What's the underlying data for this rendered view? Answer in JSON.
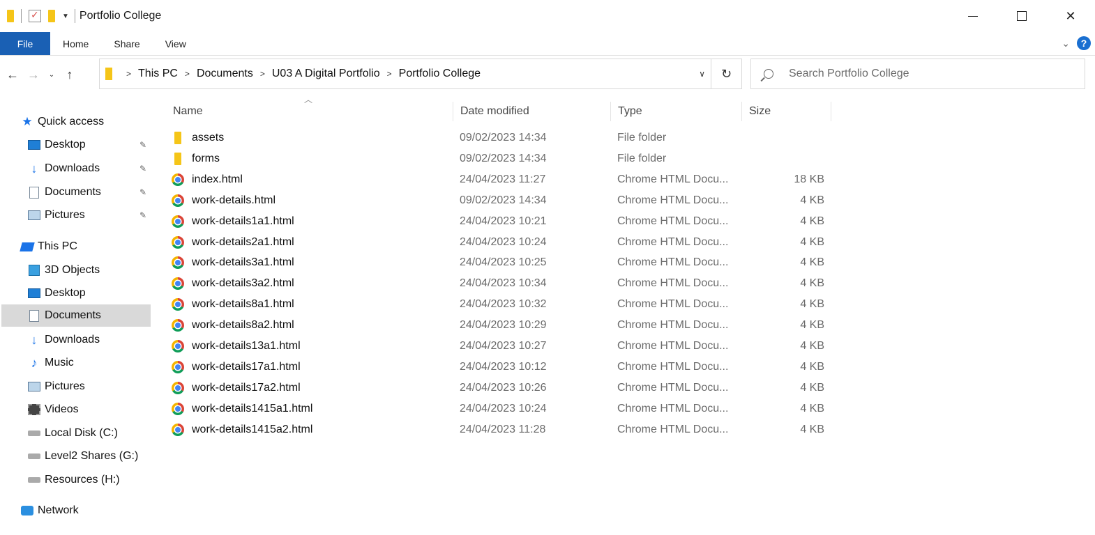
{
  "window": {
    "title": "Portfolio College",
    "minimize": "",
    "maximize": "",
    "close": "✕"
  },
  "ribbon": {
    "tabs": [
      "File",
      "Home",
      "Share",
      "View"
    ],
    "help": "?"
  },
  "nav": {
    "back": "←",
    "forward": "→",
    "recent": "⌄",
    "up": "↑",
    "breadcrumbs": [
      "This PC",
      "Documents",
      "U03 A Digital Portfolio",
      "Portfolio College"
    ],
    "refresh": "↻"
  },
  "search": {
    "placeholder": "Search Portfolio College"
  },
  "sidebar": {
    "quick_access": "Quick access",
    "quick_items": [
      "Desktop",
      "Downloads",
      "Documents",
      "Pictures"
    ],
    "this_pc": "This PC",
    "pc_items": [
      "3D Objects",
      "Desktop",
      "Documents",
      "Downloads",
      "Music",
      "Pictures",
      "Videos",
      "Local Disk (C:)",
      "Level2 Shares (G:)",
      "Resources (H:)"
    ],
    "network": "Network",
    "selected": "Documents"
  },
  "columns": {
    "name": "Name",
    "date": "Date modified",
    "type": "Type",
    "size": "Size"
  },
  "files": [
    {
      "name": "assets",
      "date": "09/02/2023 14:34",
      "type": "File folder",
      "size": "",
      "icon": "folder-icon"
    },
    {
      "name": "forms",
      "date": "09/02/2023 14:34",
      "type": "File folder",
      "size": "",
      "icon": "folder-icon"
    },
    {
      "name": "index.html",
      "date": "24/04/2023 11:27",
      "type": "Chrome HTML Docu...",
      "size": "18 KB",
      "icon": "chrome-icon"
    },
    {
      "name": "work-details.html",
      "date": "09/02/2023 14:34",
      "type": "Chrome HTML Docu...",
      "size": "4 KB",
      "icon": "chrome-icon"
    },
    {
      "name": "work-details1a1.html",
      "date": "24/04/2023 10:21",
      "type": "Chrome HTML Docu...",
      "size": "4 KB",
      "icon": "chrome-icon"
    },
    {
      "name": "work-details2a1.html",
      "date": "24/04/2023 10:24",
      "type": "Chrome HTML Docu...",
      "size": "4 KB",
      "icon": "chrome-icon"
    },
    {
      "name": "work-details3a1.html",
      "date": "24/04/2023 10:25",
      "type": "Chrome HTML Docu...",
      "size": "4 KB",
      "icon": "chrome-icon"
    },
    {
      "name": "work-details3a2.html",
      "date": "24/04/2023 10:34",
      "type": "Chrome HTML Docu...",
      "size": "4 KB",
      "icon": "chrome-icon"
    },
    {
      "name": "work-details8a1.html",
      "date": "24/04/2023 10:32",
      "type": "Chrome HTML Docu...",
      "size": "4 KB",
      "icon": "chrome-icon"
    },
    {
      "name": "work-details8a2.html",
      "date": "24/04/2023 10:29",
      "type": "Chrome HTML Docu...",
      "size": "4 KB",
      "icon": "chrome-icon"
    },
    {
      "name": "work-details13a1.html",
      "date": "24/04/2023 10:27",
      "type": "Chrome HTML Docu...",
      "size": "4 KB",
      "icon": "chrome-icon"
    },
    {
      "name": "work-details17a1.html",
      "date": "24/04/2023 10:12",
      "type": "Chrome HTML Docu...",
      "size": "4 KB",
      "icon": "chrome-icon"
    },
    {
      "name": "work-details17a2.html",
      "date": "24/04/2023 10:26",
      "type": "Chrome HTML Docu...",
      "size": "4 KB",
      "icon": "chrome-icon"
    },
    {
      "name": "work-details1415a1.html",
      "date": "24/04/2023 10:24",
      "type": "Chrome HTML Docu...",
      "size": "4 KB",
      "icon": "chrome-icon"
    },
    {
      "name": "work-details1415a2.html",
      "date": "24/04/2023 11:28",
      "type": "Chrome HTML Docu...",
      "size": "4 KB",
      "icon": "chrome-icon"
    }
  ],
  "colors": {
    "file_tab": "#1a60b4",
    "folder": "#f5c518",
    "selected_bg": "#d9d9d9"
  }
}
